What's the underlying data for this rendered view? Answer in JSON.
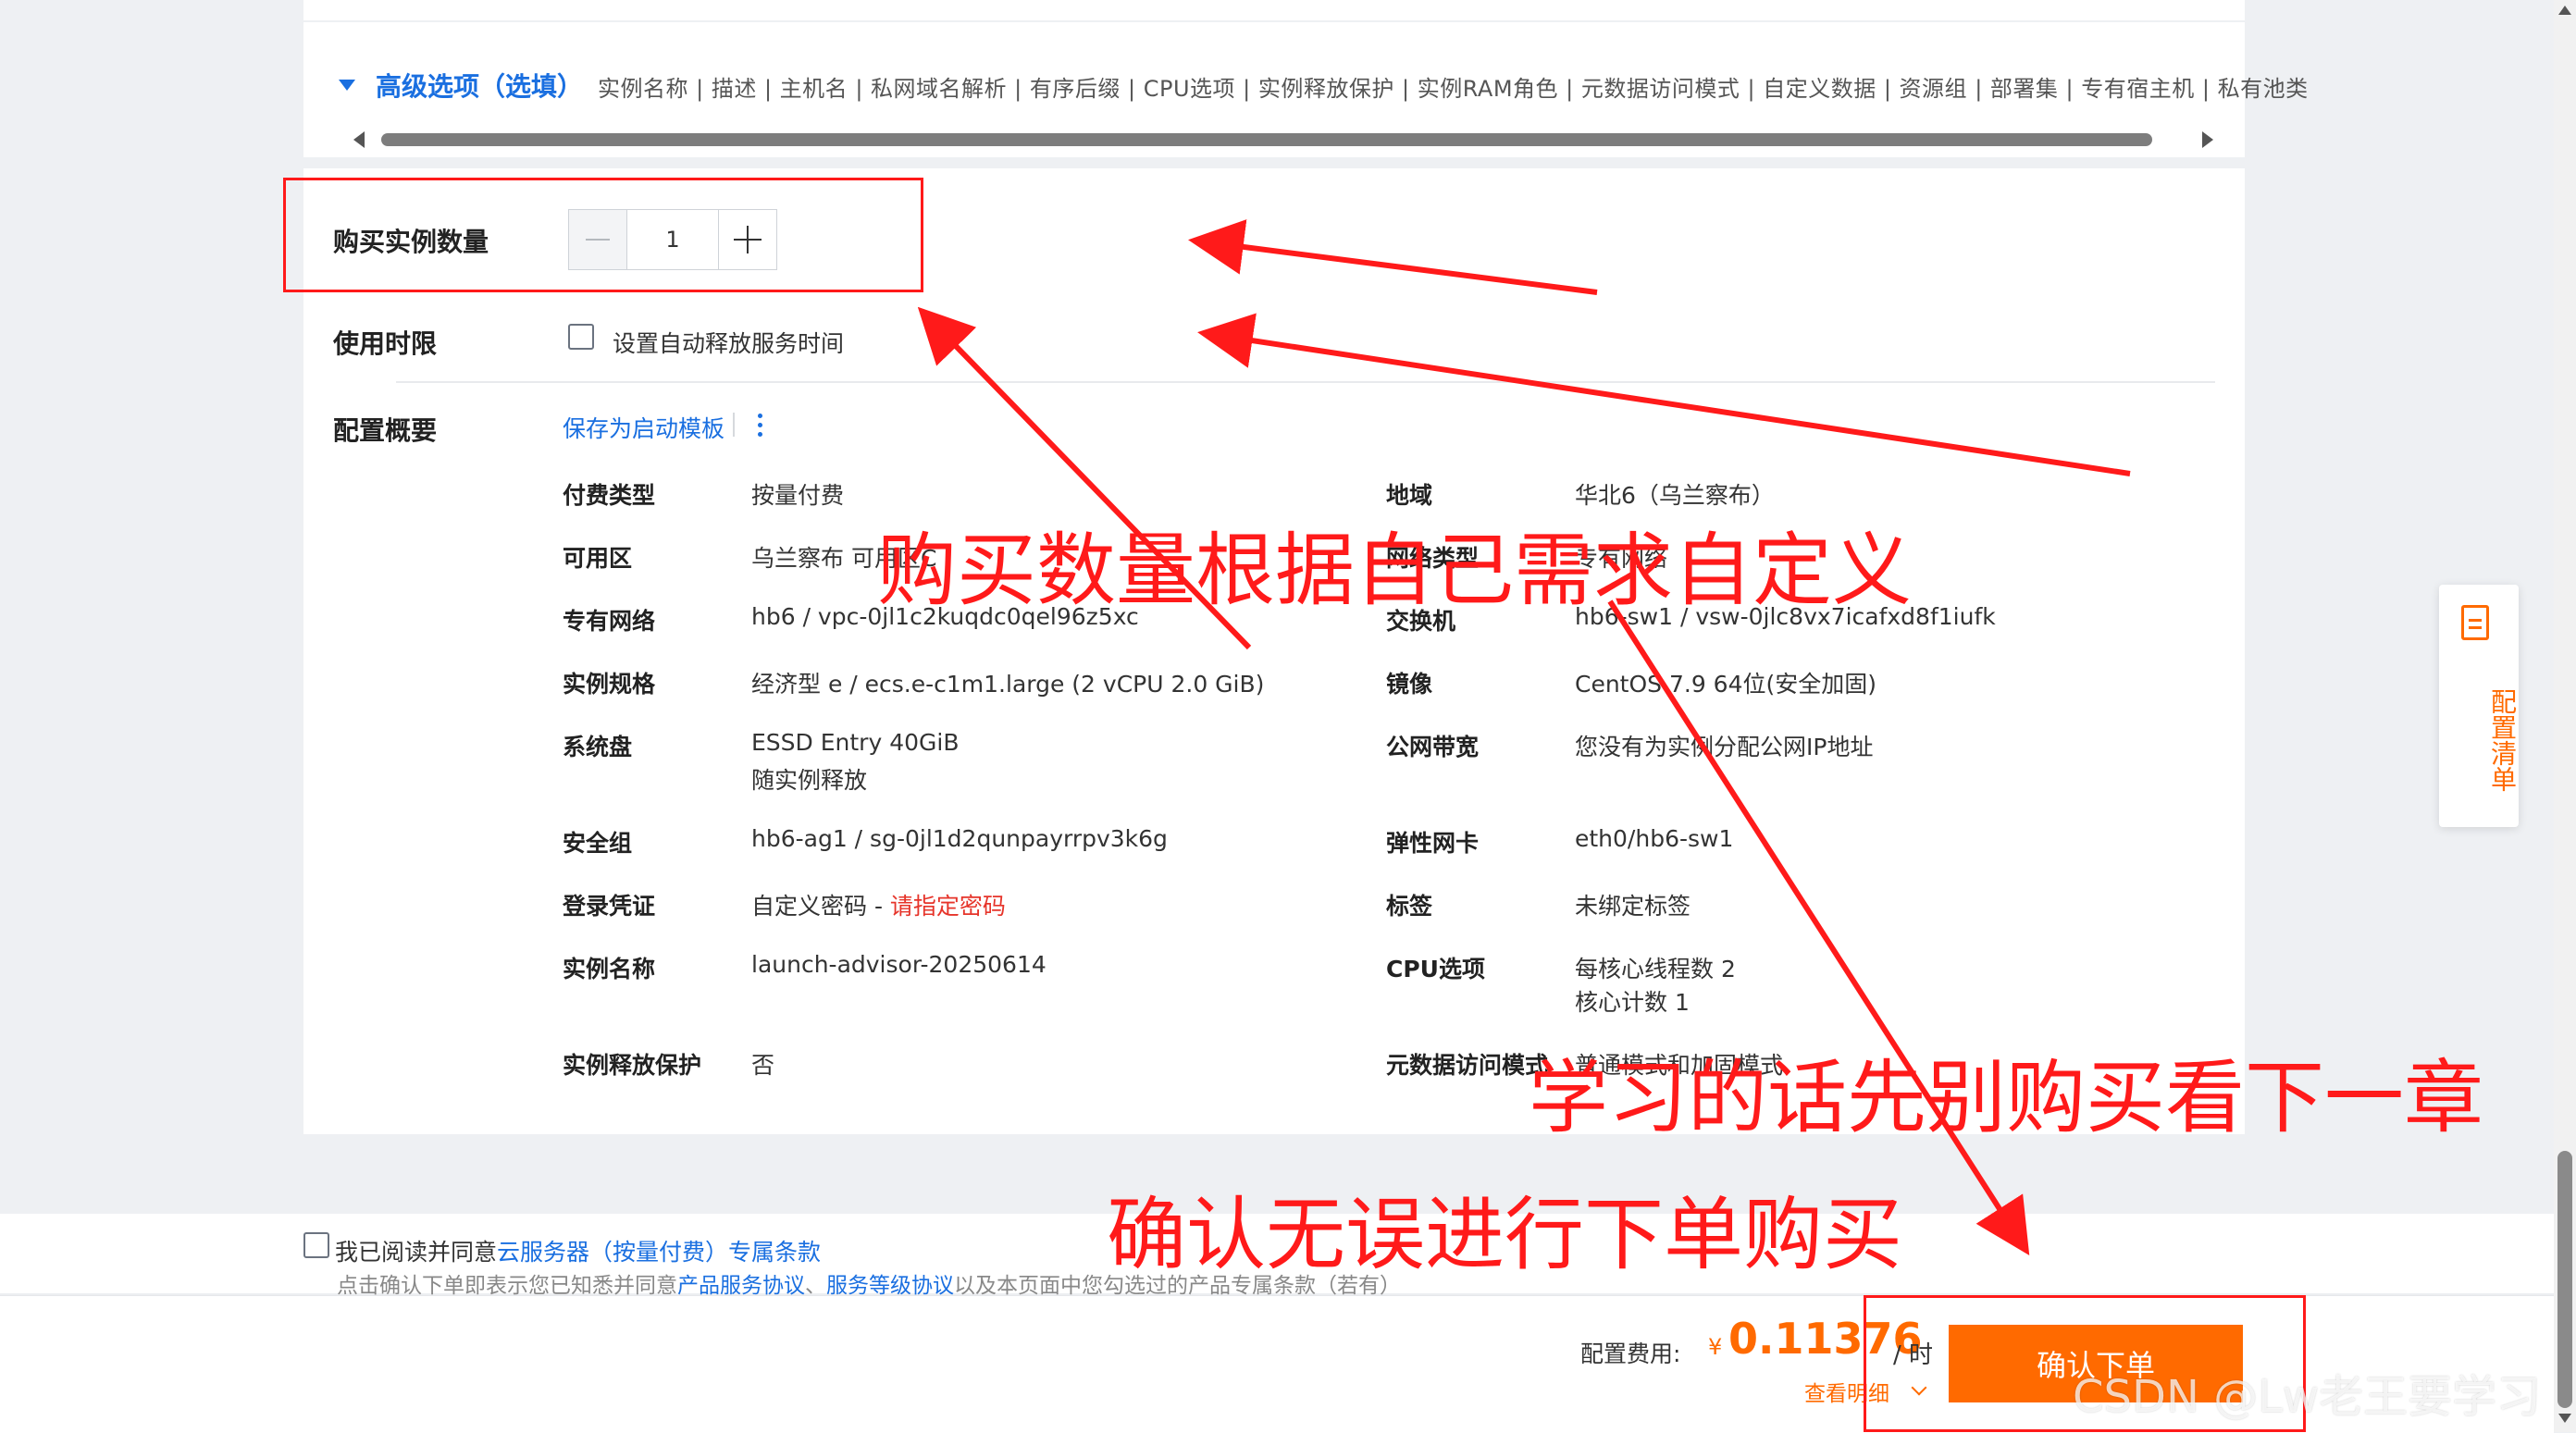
{
  "advanced": {
    "title": "高级选项（选填）",
    "links": "实例名称 | 描述 | 主机名 | 私网域名解析 | 有序后缀 | CPU选项 | 实例释放保护 | 实例RAM角色 | 元数据访问模式 | 自定义数据 | 资源组 | 部署集 | 专有宿主机 | 私有池类"
  },
  "quantity": {
    "label": "购买实例数量",
    "value": "1"
  },
  "duration": {
    "label": "使用时限",
    "checkbox_label": "设置自动释放服务时间"
  },
  "summary": {
    "label": "配置概要",
    "save_template": "保存为启动模板",
    "left": [
      {
        "key": "付费类型",
        "value": "按量付费"
      },
      {
        "key": "可用区",
        "value": "乌兰察布 可用区C"
      },
      {
        "key": "专有网络",
        "value": "hb6 / vpc-0jl1c2kuqdc0qel96z5xc"
      },
      {
        "key": "实例规格",
        "value": "经济型 e / ecs.e-c1m1.large (2 vCPU 2.0 GiB)"
      },
      {
        "key": "系统盘",
        "value": "ESSD Entry 40GiB",
        "value2": "随实例释放"
      },
      {
        "key": "安全组",
        "value": "hb6-ag1 / sg-0jl1d2qunpayrrpv3k6g"
      },
      {
        "key": "登录凭证",
        "value": "自定义密码 - ",
        "value_link": "请指定密码"
      },
      {
        "key": "实例名称",
        "value": "launch-advisor-20250614"
      },
      {
        "key": "实例释放保护",
        "value": "否"
      }
    ],
    "right": [
      {
        "key": "地域",
        "value": "华北6（乌兰察布）"
      },
      {
        "key": "网络类型",
        "value": "专有网络"
      },
      {
        "key": "交换机",
        "value": "hb6-sw1 / vsw-0jlc8vx7icafxd8f1iufk"
      },
      {
        "key": "镜像",
        "value": "CentOS 7.9 64位(安全加固)"
      },
      {
        "key": "公网带宽",
        "value": "您没有为实例分配公网IP地址"
      },
      {
        "key": "弹性网卡",
        "value": "eth0/hb6-sw1"
      },
      {
        "key": "标签",
        "value": "未绑定标签"
      },
      {
        "key": "CPU选项",
        "value": "每核心线程数 2",
        "value2": "核心计数 1"
      },
      {
        "key": "元数据访问模式",
        "value": "普通模式和加固模式"
      }
    ]
  },
  "side_panel": {
    "label": "配置清单",
    "icon": "document-icon"
  },
  "agreement": {
    "prefix": "我已阅读并同意",
    "link": "云服务器（按量付费）专属条款",
    "note_prefix": "点击确认下单即表示您已知悉并同意",
    "note_link1": "产品服务协议",
    "note_sep": "、",
    "note_link2": "服务等级协议",
    "note_suffix": "以及本页面中您勾选过的产品专属条款（若有）"
  },
  "footer": {
    "price_label": "配置费用:",
    "currency": "¥",
    "price": "0.11376",
    "unit": "/ 时",
    "detail_link": "查看明细",
    "order_button": "确认下单"
  },
  "annotations": {
    "text1": "购买数量根据自己需求自定义",
    "text2": "学习的话先别购买看下一章",
    "text3": "确认无误进行下单购买",
    "color": "#ff1a1a"
  },
  "watermark": "CSDN @Lw老王要学习",
  "colors": {
    "accent": "#1a6fe0",
    "brand": "#ff6a00",
    "danger": "#e6342a"
  }
}
